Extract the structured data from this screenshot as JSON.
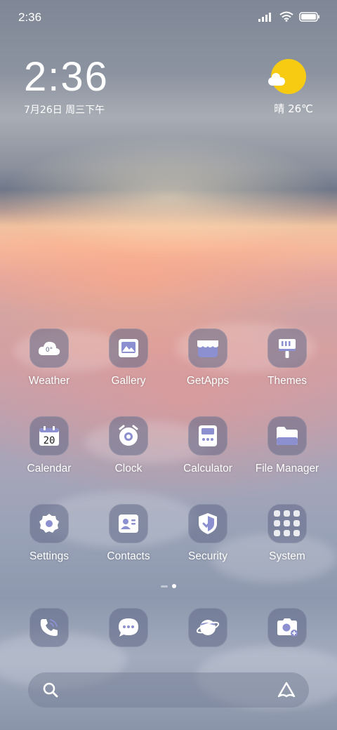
{
  "status_bar": {
    "time": "2:36"
  },
  "clock_widget": {
    "time": "2:36",
    "date": "7月26日 周三下午"
  },
  "weather_widget": {
    "condition_temp": "晴 26℃",
    "icon": "sun-cloud-icon"
  },
  "apps": [
    {
      "label": "Weather",
      "icon": "weather-icon",
      "badge": "0°"
    },
    {
      "label": "Gallery",
      "icon": "gallery-icon"
    },
    {
      "label": "GetApps",
      "icon": "getapps-icon"
    },
    {
      "label": "Themes",
      "icon": "themes-icon"
    },
    {
      "label": "Calendar",
      "icon": "calendar-icon",
      "badge": "20"
    },
    {
      "label": "Clock",
      "icon": "clock-icon"
    },
    {
      "label": "Calculator",
      "icon": "calculator-icon"
    },
    {
      "label": "File Manager",
      "icon": "folder-icon"
    },
    {
      "label": "Settings",
      "icon": "gear-icon"
    },
    {
      "label": "Contacts",
      "icon": "contacts-icon"
    },
    {
      "label": "Security",
      "icon": "shield-icon"
    },
    {
      "label": "System",
      "icon": "folder-grid-icon"
    }
  ],
  "dock": [
    {
      "icon": "phone-icon"
    },
    {
      "icon": "messages-icon"
    },
    {
      "icon": "browser-icon"
    },
    {
      "icon": "camera-icon"
    }
  ],
  "search_bar": {
    "left_icon": "search-icon",
    "right_icon": "assistant-icon"
  },
  "colors": {
    "icon_bg": "#606886",
    "icon_glyph": "#ffffff",
    "icon_accent": "#8c8fd0",
    "sun": "#f6cb12"
  }
}
